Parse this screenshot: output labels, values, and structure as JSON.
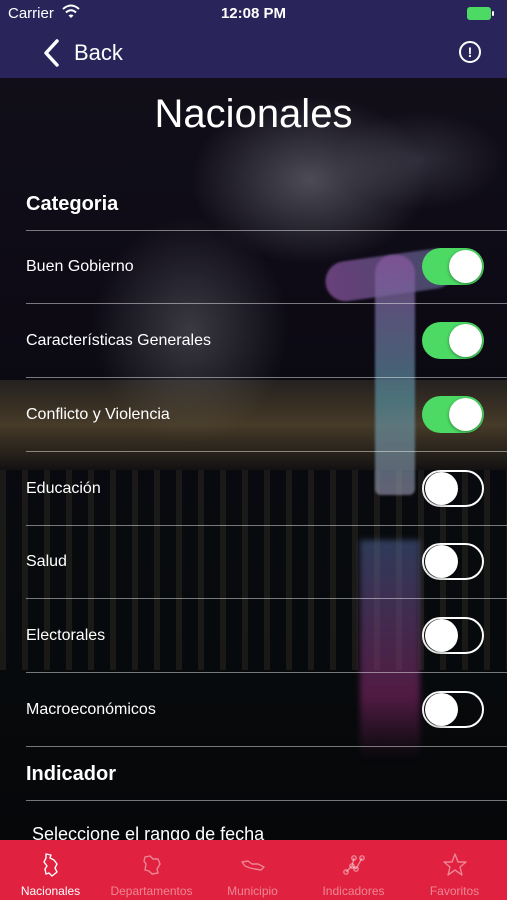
{
  "status_bar": {
    "carrier": "Carrier",
    "time": "12:08 PM"
  },
  "nav": {
    "back_label": "Back",
    "info_icon": "exclamation-circle-icon"
  },
  "page": {
    "title": "Nacionales"
  },
  "categoria": {
    "header": "Categoria",
    "items": [
      {
        "label": "Buen Gobierno",
        "enabled": true
      },
      {
        "label": "Características Generales",
        "enabled": true
      },
      {
        "label": "Conflicto y Violencia",
        "enabled": true
      },
      {
        "label": "Educación",
        "enabled": false
      },
      {
        "label": "Salud",
        "enabled": false
      },
      {
        "label": "Electorales",
        "enabled": false
      },
      {
        "label": "Macroeconómicos",
        "enabled": false
      }
    ]
  },
  "indicador": {
    "header": "Indicador",
    "date_range_label": "Seleccione el rango de fecha"
  },
  "tab_bar": {
    "active": "Nacionales",
    "tabs": [
      {
        "label": "Nacionales",
        "icon": "colombia-map-icon"
      },
      {
        "label": "Departamentos",
        "icon": "department-map-icon"
      },
      {
        "label": "Municipio",
        "icon": "municipality-map-icon"
      },
      {
        "label": "Indicadores",
        "icon": "network-nodes-icon"
      },
      {
        "label": "Favoritos",
        "icon": "star-icon"
      }
    ]
  },
  "colors": {
    "nav_bar": "#29255a",
    "tab_bar": "#e0213f",
    "toggle_on": "#4cd964"
  }
}
